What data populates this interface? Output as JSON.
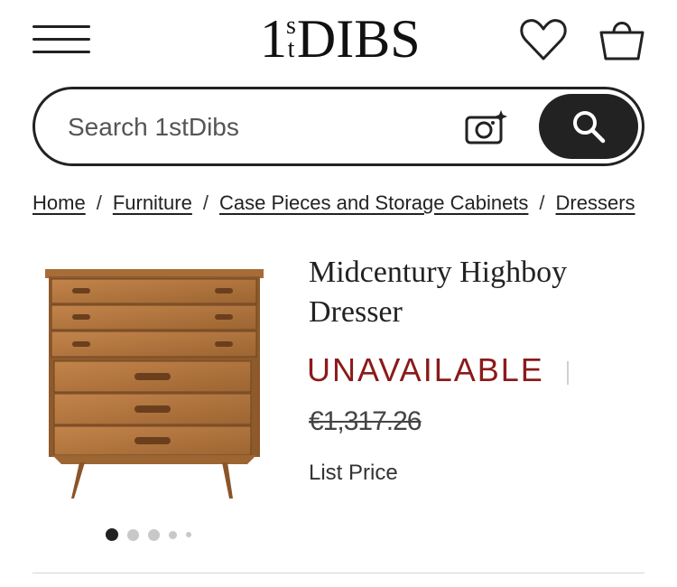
{
  "header": {
    "logo_part1": "1",
    "logo_sup1": "s",
    "logo_sup2": "t",
    "logo_part2": "DIBS",
    "icons": [
      "menu-icon",
      "heart-icon",
      "shopping-bag-icon"
    ]
  },
  "search": {
    "placeholder": "Search 1stDibs",
    "icons": [
      "camera-sparkle-icon",
      "search-icon"
    ]
  },
  "breadcrumb": {
    "items": [
      "Home",
      "Furniture",
      "Case Pieces and Storage Cabinets",
      "Dressers"
    ],
    "separator": "/"
  },
  "product": {
    "title": "Midcentury Highboy Dresser",
    "availability": "UNAVAILABLE",
    "old_price": "€1,317.26",
    "price_label": "List Price"
  },
  "carousel": {
    "total_dots": 5,
    "active_index": 0
  },
  "colors": {
    "text": "#222222",
    "unavailable": "#8b1a1a",
    "wood": "#b0743e",
    "dot_inactive": "#c8c8c8"
  }
}
